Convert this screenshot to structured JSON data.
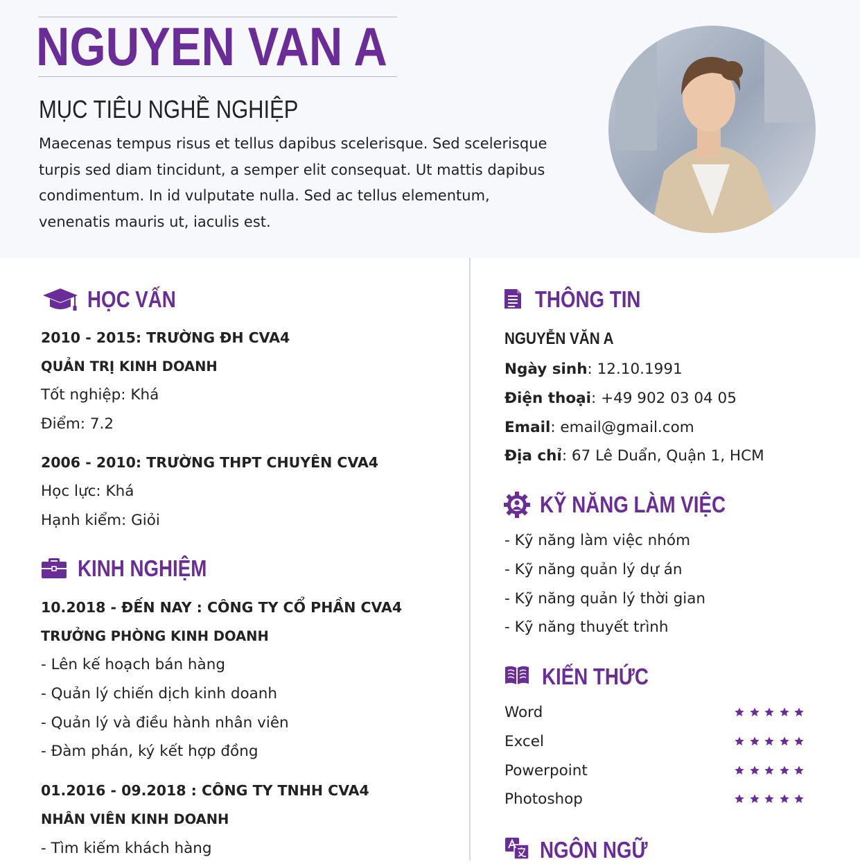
{
  "header": {
    "name": "NGUYEN VAN A",
    "objective_title": "MỤC TIÊU NGHỀ NGHIỆP",
    "objective_text": "Maecenas tempus risus et tellus dapibus scelerisque. Sed scelerisque turpis sed diam tincidunt, a semper elit consequat. Ut mattis dapibus condimentum. In id vulputate nulla. Sed ac tellus elementum, venenatis mauris ut, iaculis est."
  },
  "education": {
    "title": "HỌC VẤN",
    "entries": [
      {
        "heading": "2010 - 2015: TRƯỜNG ĐH CVA4",
        "major": "QUẢN TRỊ KINH DOANH",
        "lines": [
          "Tốt nghiệp: Khá",
          "Điểm: 7.2"
        ]
      },
      {
        "heading": "2006 - 2010: TRƯỜNG THPT CHUYÊN CVA4",
        "lines": [
          "Học lực: Khá",
          "Hạnh kiểm: Giỏi"
        ]
      }
    ]
  },
  "experience": {
    "title": "KINH NGHIỆM",
    "entries": [
      {
        "heading": "10.2018 - ĐẾN NAY : CÔNG TY CỔ PHẦN CVA4",
        "role": "TRƯỞNG PHÒNG KINH DOANH",
        "lines": [
          "- Lên kế hoạch bán hàng",
          "- Quản lý chiến dịch kinh doanh",
          "- Quản lý và điều hành nhân viên",
          "- Đàm phán, ký kết hợp đồng"
        ]
      },
      {
        "heading": "01.2016 - 09.2018 : CÔNG TY TNHH CVA4",
        "role": "NHÂN VIÊN KINH DOANH",
        "lines": [
          "- Tìm kiếm khách hàng"
        ]
      }
    ]
  },
  "info": {
    "title": "THÔNG TIN",
    "full_name": "NGUYỄN VĂN A",
    "fields": [
      {
        "label": "Ngày sinh",
        "value": ": 12.10.1991"
      },
      {
        "label": "Điện thoại",
        "value": ": +49 902 03 04 05"
      },
      {
        "label": "Email",
        "value": ": email@gmail.com"
      },
      {
        "label": "Địa chỉ",
        "value": ": 67 Lê Duẩn, Quận 1, HCM"
      }
    ]
  },
  "skills": {
    "title": "KỸ NĂNG LÀM VIỆC",
    "items": [
      "- Kỹ năng làm việc nhóm",
      "- Kỹ năng quản lý dự án",
      "- Kỹ năng quản lý thời gian",
      "- Kỹ năng thuyết trình"
    ]
  },
  "knowledge": {
    "title": "KIẾN THỨC",
    "items": [
      {
        "name": "Word",
        "stars": 5
      },
      {
        "name": "Excel",
        "stars": 5
      },
      {
        "name": "Powerpoint",
        "stars": 5
      },
      {
        "name": "Photoshop",
        "stars": 5
      }
    ]
  },
  "languages": {
    "title": "NGÔN NGỮ"
  },
  "colors": {
    "accent": "#6a2d98",
    "header_bg": "#f7f8fb",
    "text": "#222222"
  },
  "icons": {
    "education": "graduation-cap-icon",
    "experience": "briefcase-icon",
    "info": "document-icon",
    "skills": "gear-person-icon",
    "knowledge": "open-book-icon",
    "languages": "translate-icon"
  }
}
